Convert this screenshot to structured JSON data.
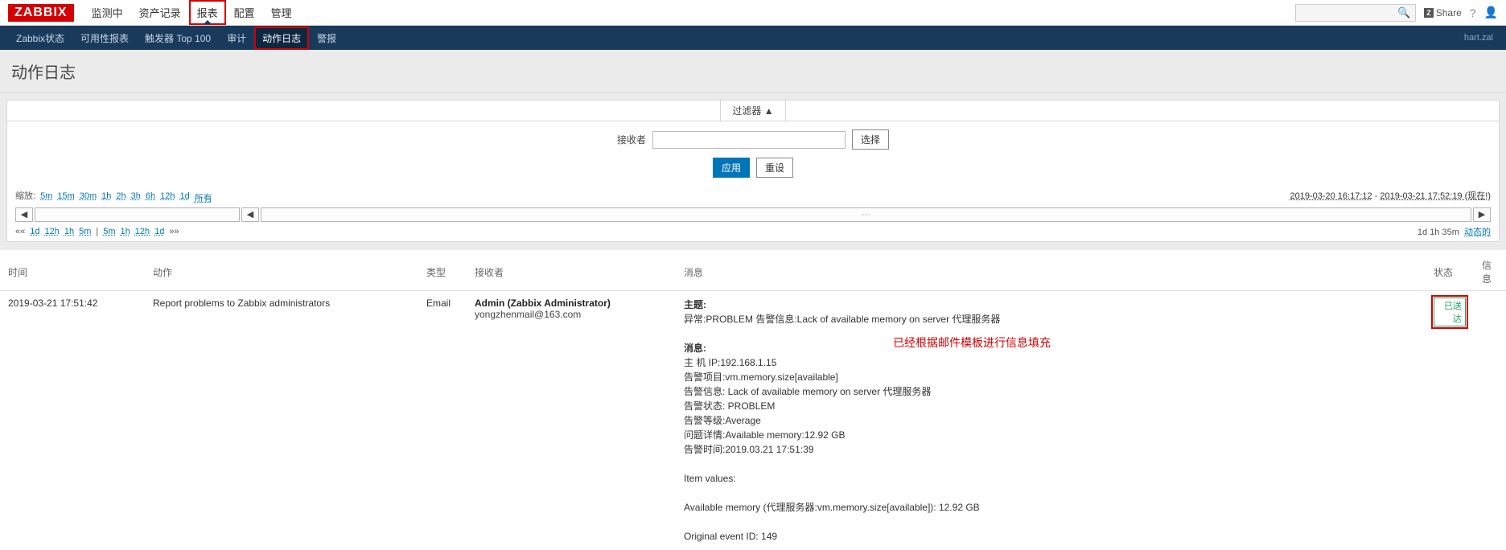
{
  "brand": "ZABBIX",
  "topmenu": [
    "监测中",
    "资产记录",
    "报表",
    "配置",
    "管理"
  ],
  "topmenu_active": 2,
  "share": "Share",
  "subnav": [
    "Zabbix状态",
    "可用性报表",
    "触发器 Top 100",
    "审计",
    "动作日志",
    "警报"
  ],
  "subnav_active": 4,
  "subnav_user": "hart.zal",
  "page_title": "动作日志",
  "filter": {
    "tab": "过滤器 ▲",
    "recipient_label": "接收者",
    "recipient_value": "",
    "select_btn": "选择",
    "apply": "应用",
    "reset": "重设"
  },
  "zoom": {
    "label": "缩放:",
    "links": [
      "5m",
      "15m",
      "30m",
      "1h",
      "2h",
      "3h",
      "6h",
      "12h",
      "1d",
      "所有"
    ],
    "range_from": "2019-03-20 16:17:12",
    "range_to": "2019-03-21 17:52:19 (现在!)"
  },
  "timeline": {
    "mid": "···"
  },
  "shift": {
    "left_dbl": "««",
    "left_links": [
      "1d",
      "12h",
      "1h",
      "5m"
    ],
    "sep": "|",
    "right_links": [
      "5m",
      "1h",
      "12h",
      "1d"
    ],
    "right_dbl": "»»",
    "summary": "1d 1h 35m",
    "dynamic": "动态的"
  },
  "table": {
    "headers": {
      "time": "时间",
      "action": "动作",
      "type": "类型",
      "recv": "接收者",
      "msg": "消息",
      "status": "状态",
      "info": "信息"
    },
    "rows": [
      {
        "time": "2019-03-21 17:51:42",
        "action": "Report problems to Zabbix administrators",
        "type": "Email",
        "recv_name": "Admin (Zabbix Administrator)",
        "recv_mail": "yongzhenmail@163.com",
        "subject_label": "主题:",
        "subject": "异常:PROBLEM 告警信息:Lack of available memory on server 代理服务器",
        "msg_label": "消息:",
        "body": [
          "主 机 IP:192.168.1.15",
          "告警项目:vm.memory.size[available]",
          "告警信息: Lack of available memory on server 代理服务器",
          "告警状态: PROBLEM",
          "告警等级:Average",
          "问题详情:Available memory:12.92 GB",
          "告警时间:2019.03.21 17:51:39",
          "",
          "Item values:",
          "",
          "Available memory (代理服务器:vm.memory.size[available]): 12.92 GB",
          "",
          "Original event ID: 149"
        ],
        "status": "已送达"
      }
    ]
  },
  "annotation": "已经根据邮件模板进行信息填充"
}
